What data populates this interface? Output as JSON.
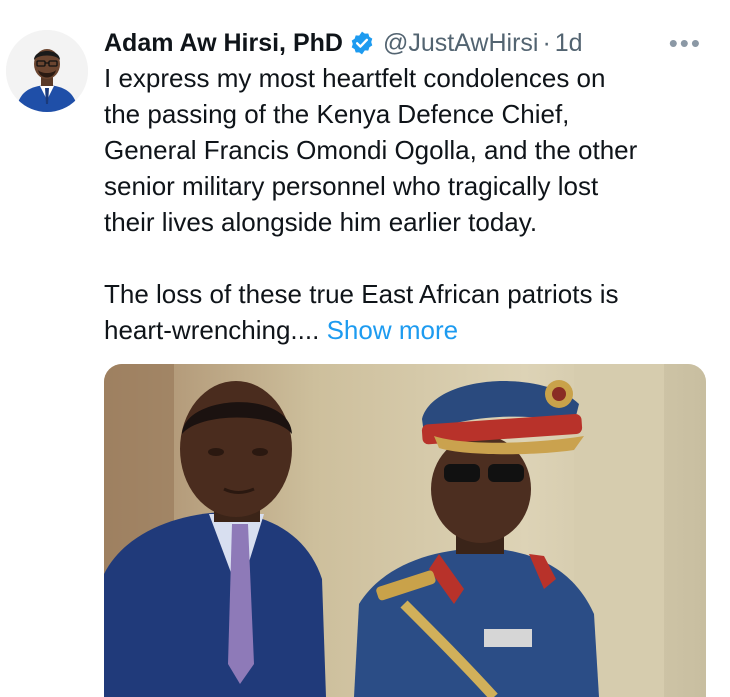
{
  "tweet": {
    "author": {
      "display_name": "Adam Aw Hirsi, PhD",
      "verified": true,
      "handle": "@JustAwHirsi",
      "separator": "·",
      "time": "1d"
    },
    "more_icon": "more-horizontal-icon",
    "text": {
      "para1_line1": "I express my most heartfelt condolences on",
      "para1_line2": "the passing of the Kenya Defence Chief,",
      "para1_line3": "General Francis Omondi Ogolla, and the other",
      "para1_line4": "senior military personnel who tragically lost",
      "para1_line5": "their lives alongside him earlier today.",
      "para2_line1": "The loss of these true East African patriots is",
      "para2_line2": "heart-wrenching....",
      "show_more": "Show more"
    },
    "colors": {
      "text": "#0f1419",
      "secondary": "#536471",
      "link": "#1d9bf0",
      "verified_badge": "#1d9bf0"
    }
  }
}
